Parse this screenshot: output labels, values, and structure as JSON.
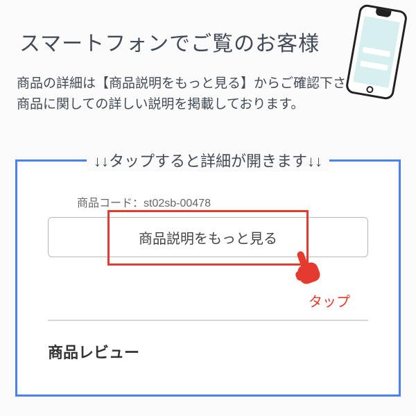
{
  "heading": "スマートフォンでご覧のお客様",
  "description_line1": "商品の詳細は【商品説明をもっと見る】からご確認下さい。",
  "description_line2": "商品に関しての詳しい説明を掲載しております。",
  "frame_legend": "↓↓タップすると詳細が開きます↓↓",
  "product_code_label": "商品コード：",
  "product_code_value": "st02sb-00478",
  "button_label": "商品説明をもっと見る",
  "tap_label": "タップ",
  "review_heading": "商品レビュー"
}
